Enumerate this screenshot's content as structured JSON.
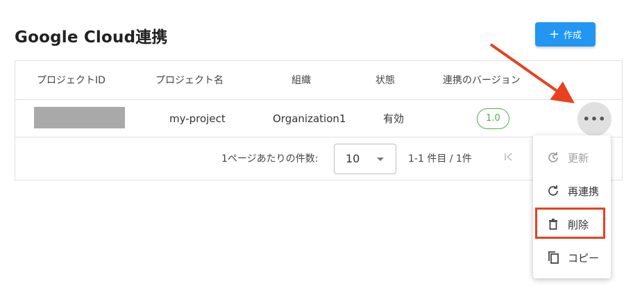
{
  "page": {
    "title": "Google Cloud連携"
  },
  "toolbar": {
    "create_label": "作成",
    "create_icon": "plus-icon"
  },
  "table": {
    "headers": [
      "プロジェクトID",
      "プロジェクト名",
      "組織",
      "状態",
      "連携のバージョン"
    ],
    "rows": [
      {
        "project_id": "",
        "project_name": "my-project",
        "organization": "Organization1",
        "status": "有効",
        "version": "1.0"
      }
    ]
  },
  "pagination": {
    "rows_per_page_label": "1ページあたりの件数:",
    "rows_per_page_value": "10",
    "range_text": "1-1 件目 / 1件",
    "first_page_icon": "first-page-icon"
  },
  "context_menu": {
    "items": [
      {
        "label": "更新",
        "icon": "update-icon",
        "disabled": true
      },
      {
        "label": "再連携",
        "icon": "refresh-icon",
        "disabled": false
      },
      {
        "label": "削除",
        "icon": "trash-icon",
        "disabled": false
      },
      {
        "label": "コピー",
        "icon": "copy-icon",
        "disabled": false
      }
    ]
  },
  "colors": {
    "primary": "#2196f3",
    "status_green": "#4caf50",
    "annotation_red": "#e8411e"
  }
}
